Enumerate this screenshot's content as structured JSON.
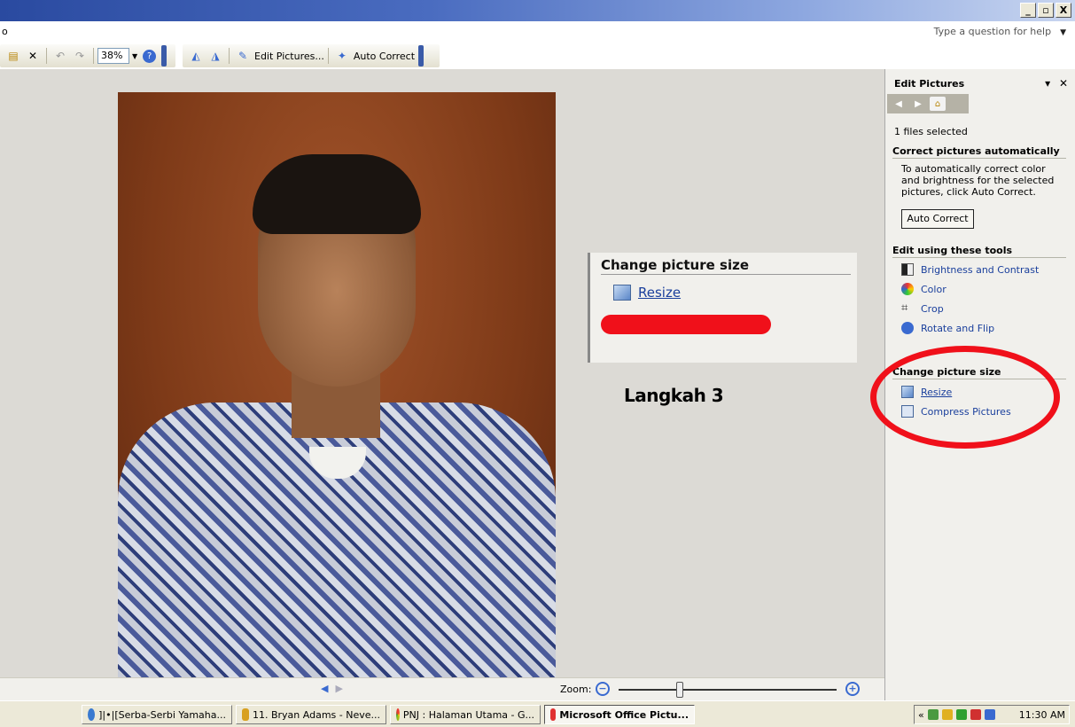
{
  "window": {
    "min": "_",
    "max": "▫",
    "close": "X"
  },
  "menu": {
    "partial": "o",
    "help_placeholder": "Type a question for help"
  },
  "toolbar": {
    "zoom": "38%",
    "edit_pictures": "Edit Pictures...",
    "auto_correct": "Auto Correct"
  },
  "callout": {
    "title": "Change picture size",
    "link": "Resize"
  },
  "annotation": {
    "text": "Langkah 3",
    "color": "#f0101a"
  },
  "zoom": {
    "label": "Zoom:"
  },
  "pane": {
    "title": "Edit Pictures",
    "files_selected": "1 files selected",
    "section_auto": "Correct pictures automatically",
    "auto_desc": "To automatically correct color and brightness for the selected pictures, click Auto Correct.",
    "auto_button": "Auto Correct",
    "section_tools": "Edit using these tools",
    "tools": [
      "Brightness and Contrast",
      "Color",
      "Crop",
      "Rotate and Flip"
    ],
    "section_size": "Change picture size",
    "size_tools": [
      "Resize",
      "Compress Pictures"
    ]
  },
  "taskbar": {
    "items": [
      "]|•|[Serba-Serbi Yamaha...",
      "11. Bryan Adams - Neve...",
      "PNJ : Halaman Utama - G...",
      "Microsoft Office Pictu..."
    ],
    "clock": "11:30 AM"
  }
}
